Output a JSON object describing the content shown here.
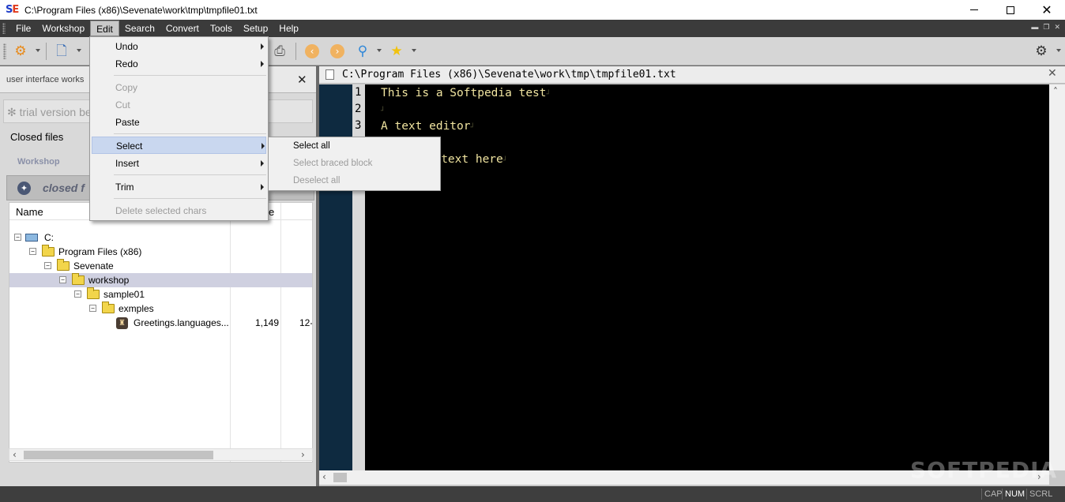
{
  "window": {
    "title": "C:\\Program Files (x86)\\Sevenate\\work\\tmp\\tmpfile01.txt",
    "logo": "SE"
  },
  "menubar": {
    "items": [
      "File",
      "Workshop",
      "Edit",
      "Search",
      "Convert",
      "Tools",
      "Setup",
      "Help"
    ],
    "active": "Edit"
  },
  "edit_menu": {
    "items": [
      {
        "label": "Undo",
        "enabled": true,
        "submenu": true
      },
      {
        "label": "Redo",
        "enabled": true,
        "submenu": true
      },
      {
        "label": "Copy",
        "enabled": false,
        "submenu": false
      },
      {
        "label": "Cut",
        "enabled": false,
        "submenu": false
      },
      {
        "label": "Paste",
        "enabled": true,
        "submenu": false
      },
      {
        "label": "Select",
        "enabled": true,
        "submenu": true,
        "highlighted": true
      },
      {
        "label": "Insert",
        "enabled": true,
        "submenu": true
      },
      {
        "label": "Trim",
        "enabled": true,
        "submenu": true
      },
      {
        "label": "Delete selected chars",
        "enabled": false,
        "submenu": false
      }
    ]
  },
  "select_submenu": {
    "items": [
      {
        "label": "Select all",
        "enabled": true
      },
      {
        "label": "Select braced block",
        "enabled": false
      },
      {
        "label": "Deselect all",
        "enabled": false
      }
    ]
  },
  "left_panel": {
    "workspace_title": "user interface works",
    "trial_text": "✻ trial version be",
    "closed_files_label": "Closed files",
    "workshop_tab": "Workshop",
    "closed_banner_text": "closed f",
    "tree": {
      "columns": [
        "Name",
        "e"
      ],
      "rows": [
        {
          "label": "C:",
          "icon": "drive-icon",
          "size": "",
          "date": ""
        },
        {
          "label": "Program Files (x86)",
          "icon": "folder-icon",
          "size": "",
          "date": ""
        },
        {
          "label": "Sevenate",
          "icon": "folder-icon",
          "size": "",
          "date": ""
        },
        {
          "label": "workshop",
          "icon": "folder-icon",
          "size": "",
          "date": "",
          "selected": true
        },
        {
          "label": "sample01",
          "icon": "folder-icon",
          "size": "",
          "date": ""
        },
        {
          "label": "exmples",
          "icon": "folder-icon",
          "size": "",
          "date": ""
        },
        {
          "label": "Greetings.languages...",
          "icon": "file-icon",
          "size": "1,149",
          "date": "12-"
        }
      ]
    }
  },
  "editor": {
    "title": "C:\\Program Files (x86)\\Sevenate\\work\\tmp\\tmpfile01.txt",
    "line_numbers": [
      "1",
      "2",
      "3"
    ],
    "lines": [
      "This is a Softpedia test",
      "",
      "A text editor",
      "",
      "ur text here"
    ]
  },
  "watermark": "SOFTPEDIA",
  "statusbar": {
    "segments": [
      {
        "label": "CAP",
        "on": false
      },
      {
        "label": "NUM",
        "on": true
      },
      {
        "label": "SCRL",
        "on": false
      }
    ]
  },
  "colors": {
    "menubar_bg": "#3b3b3b",
    "editor_bg": "#000000",
    "editor_text": "#f0e4a0",
    "gutter_bg": "#0e2a40",
    "menu_highlight": "#c9d7ef",
    "tree_selected": "#cfd0e0"
  }
}
